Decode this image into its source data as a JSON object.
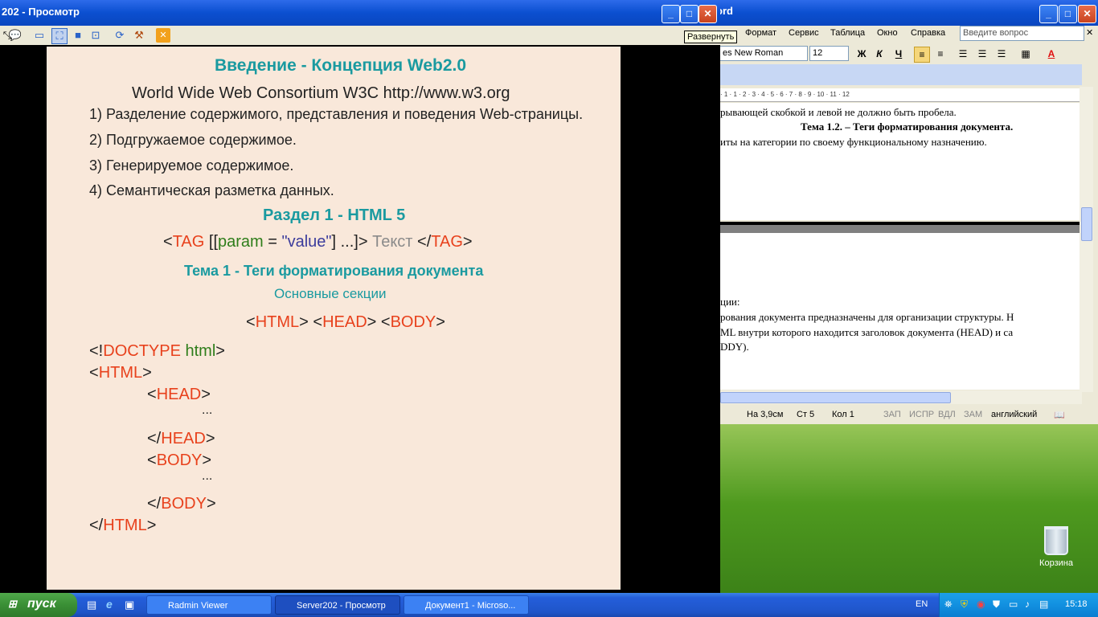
{
  "viewer": {
    "title": "202 - Просмотр",
    "tooltip": "Развернуть",
    "window_controls": [
      "minimize",
      "maximize",
      "close"
    ]
  },
  "slide": {
    "heading": "Введение - Концепция Web2.0",
    "subheading": "World Wide Web Consortium  W3C  http://www.w3.org",
    "items": [
      "1) Разделение содержимого, представления и поведения Web-страницы.",
      "2) Подгружаемое содержимое.",
      "3) Генерируемое содержимое.",
      "4) Семантическая разметка данных."
    ],
    "section": "Раздел 1 - HTML 5",
    "tag_syntax": {
      "open_bracket": "<",
      "tag": "TAG",
      "param_open": " [[",
      "param": "param",
      "equals": " = ",
      "value": "\"value\"",
      "param_close": "] ...]>",
      "text": " Текст ",
      "close_open": "</",
      "close_tag": "TAG",
      "close_bracket": ">"
    },
    "theme": "Тема 1 - Теги форматирования документа",
    "theme_sub": "Основные секции",
    "sections_line": {
      "html": "HTML",
      "head": "HEAD",
      "body": "BODY"
    },
    "code": {
      "doctype_prefix": "<!",
      "doctype": "DOCTYPE",
      "doctype_html": " html",
      "doctype_suffix": ">",
      "html": "HTML",
      "head": "HEAD",
      "body": "BODY",
      "ellipsis": "...",
      "lt": "<",
      "gt": ">",
      "lt_slash": "</"
    }
  },
  "word": {
    "title": "ord",
    "menu": [
      "Формат",
      "Сервис",
      "Таблица",
      "Окно",
      "Справка"
    ],
    "ask_placeholder": "Введите вопрос",
    "font": "es New Roman",
    "size": "12",
    "bold": "Ж",
    "italic": "К",
    "underline": "Ч",
    "ruler": "· 1 · 1 · 2 · 3 · 4 · 5 · 6 · 7 · 8 · 9 · 10 · 11 · 12",
    "doc1": [
      "рывающей скобкой и  левой не должно быть пробела.",
      "Тема 1.2. – Теги форматирования документа.",
      "иты на категории по своему функциональному назначению."
    ],
    "doc2": [
      "ции:",
      "рования документа предназначены для организации структуры. Н",
      "ML внутри которого находится заголовок документа (HEAD) и са",
      "DDY)."
    ],
    "status": {
      "pos": "На 3,9см",
      "line": "Ст 5",
      "col": "Кол 1",
      "rec": "ЗАП",
      "trk": "ИСПР",
      "ext": "ВДЛ",
      "ovr": "ЗАМ",
      "lang": "английский"
    }
  },
  "desktop": {
    "recycle_bin": "Корзина"
  },
  "taskbar": {
    "start": "пуск",
    "tasks": [
      "Radmin Viewer",
      "Server202 - Просмотр",
      "Документ1 - Microso..."
    ],
    "lang": "EN",
    "clock": "15:18"
  }
}
